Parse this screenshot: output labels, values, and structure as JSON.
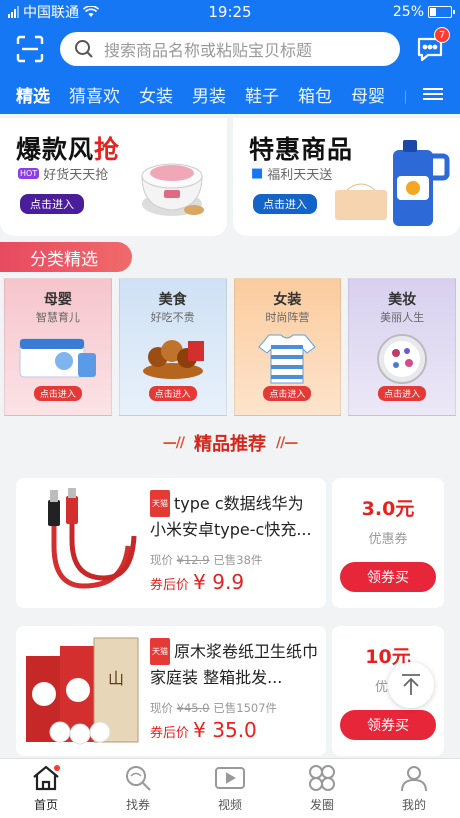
{
  "status": {
    "carrier": "中国联通",
    "time": "19:25",
    "battery": "25%"
  },
  "search": {
    "placeholder": "搜索商品名称或粘贴宝贝标题",
    "badge": "7"
  },
  "tabs": [
    "精选",
    "猜喜欢",
    "女装",
    "男装",
    "鞋子",
    "箱包",
    "母婴",
    "内"
  ],
  "promo": [
    {
      "title_a": "爆款风",
      "title_b": "抢",
      "tag": "HOT",
      "sub": "好货天天抢",
      "btn": "点击进入"
    },
    {
      "title_a": "特惠商品",
      "title_b": "",
      "sub": "福利天天送",
      "btn": "点击进入"
    }
  ],
  "section_label": "分类精选",
  "categories": [
    {
      "name": "母婴",
      "desc": "智慧育儿",
      "btn": "点击进入",
      "bg": "#f8c9ce"
    },
    {
      "name": "美食",
      "desc": "好吃不贵",
      "btn": "点击进入",
      "bg": "#d6e6f7"
    },
    {
      "name": "女装",
      "desc": "时尚阵营",
      "btn": "点击进入",
      "bg": "#fcd3b0"
    },
    {
      "name": "美妆",
      "desc": "美丽人生",
      "btn": "点击进入",
      "bg": "#ddd6f0"
    }
  ],
  "recommend": {
    "title": "精品推荐",
    "deco_left": "—//",
    "deco_right": "//—"
  },
  "products": [
    {
      "tag": "天猫",
      "title": "type c数据线华为小米安卓type-c快充...",
      "now_label": "现价",
      "orig_price": "¥12.9",
      "sold": "已售38件",
      "after_label": "券后价",
      "price": "¥ 9.9",
      "coupon": "3.0元",
      "coupon_label": "优惠券",
      "btn": "领券买"
    },
    {
      "tag": "天猫",
      "title": "原木浆卷纸卫生纸巾家庭装 整箱批发...",
      "now_label": "现价",
      "orig_price": "¥45.0",
      "sold": "已售1507件",
      "after_label": "券后价",
      "price": "¥ 35.0",
      "coupon": "10元",
      "coupon_label": "优惠",
      "btn": "领券买"
    }
  ],
  "nav": [
    {
      "label": "首页"
    },
    {
      "label": "找券"
    },
    {
      "label": "视频"
    },
    {
      "label": "发圈"
    },
    {
      "label": "我的"
    }
  ],
  "colors": {
    "brand": "#1677f5",
    "accent": "#e8211d"
  }
}
